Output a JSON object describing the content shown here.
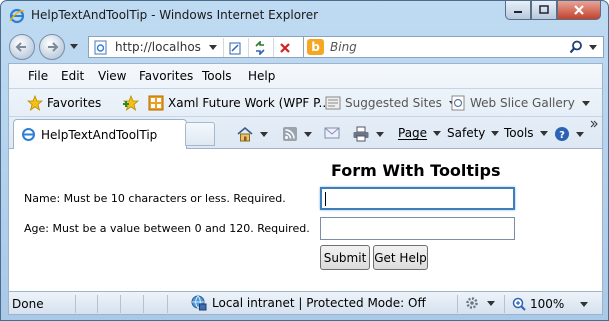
{
  "window": {
    "title": "HelpTextAndToolTip - Windows Internet Explorer"
  },
  "address_bar": {
    "url": "http://localhost:"
  },
  "search": {
    "placeholder": "Bing",
    "logo": "b"
  },
  "menu": [
    "File",
    "Edit",
    "View",
    "Favorites",
    "Tools",
    "Help"
  ],
  "favorites_bar": {
    "favorites_label": "Favorites",
    "items": [
      {
        "label": "Xaml Future Work (WPF P...",
        "icon": "page-grid-icon"
      },
      {
        "label": "Suggested Sites",
        "icon": "suggested-sites-icon"
      },
      {
        "label": "Web Slice Gallery",
        "icon": "web-slice-icon"
      }
    ]
  },
  "tab": {
    "label": "HelpTextAndToolTip"
  },
  "command_bar": {
    "page": "Page",
    "safety": "Safety",
    "tools": "Tools"
  },
  "form": {
    "title": "Form With Tooltips",
    "name_label": "Name: Must be 10 characters or less. Required.",
    "name_value": "",
    "age_label": "Age: Must be a value between 0 and 120. Required.",
    "age_value": "",
    "submit_label": "Submit",
    "help_label": "Get Help"
  },
  "status_bar": {
    "status": "Done",
    "zone": "Local intranet | Protected Mode: Off",
    "zoom": "100%"
  }
}
